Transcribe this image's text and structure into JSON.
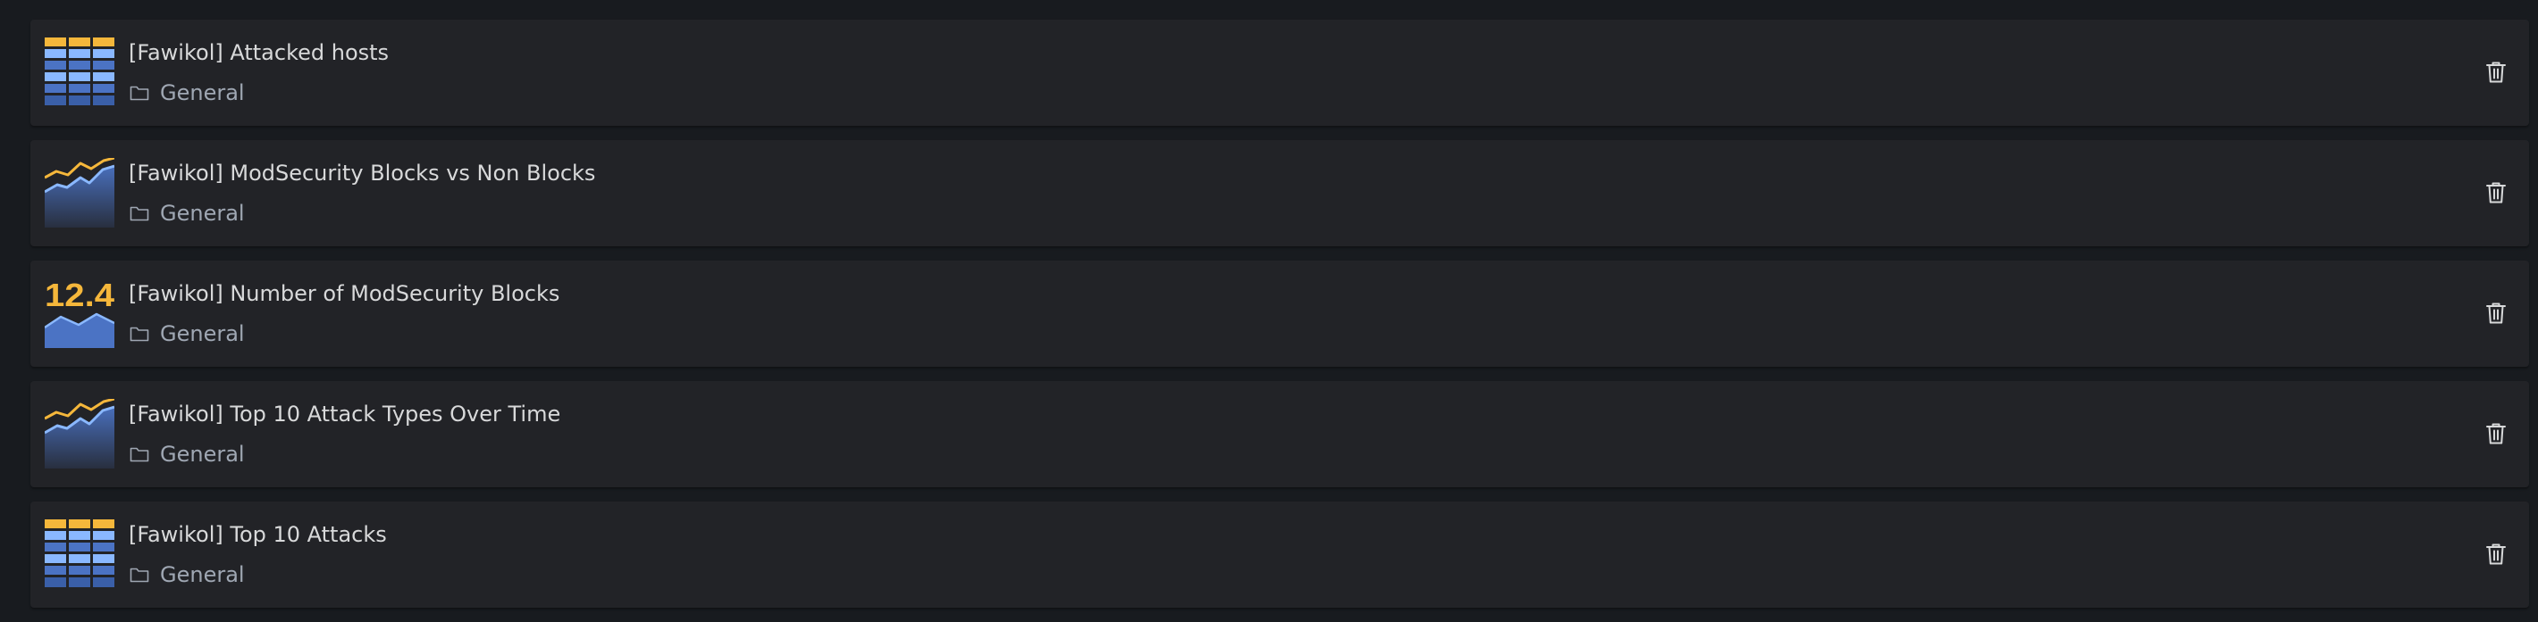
{
  "colors": {
    "background": "#181b1f",
    "card": "#222327",
    "title_text": "#d8d9da",
    "folder_text": "#9fa7b3",
    "viz_yellow": "#f5b73b",
    "viz_blue": "#4b73c4",
    "viz_light_blue": "#8ab8ff"
  },
  "panels": [
    {
      "title": "[Fawikol] Attacked hosts",
      "folder": "General",
      "viz_icon": "table-viz-icon"
    },
    {
      "title": "[Fawikol] ModSecurity Blocks vs Non Blocks",
      "folder": "General",
      "viz_icon": "timeseries-viz-icon"
    },
    {
      "title": "[Fawikol] Number of ModSecurity Blocks",
      "folder": "General",
      "viz_icon": "stat-viz-icon",
      "stat_value": "12.4"
    },
    {
      "title": "[Fawikol] Top 10 Attack Types Over Time",
      "folder": "General",
      "viz_icon": "timeseries-viz-icon"
    },
    {
      "title": "[Fawikol] Top 10 Attacks",
      "folder": "General",
      "viz_icon": "table-viz-icon"
    }
  ],
  "icons": {
    "folder": "folder-icon",
    "delete": "trash-icon"
  }
}
